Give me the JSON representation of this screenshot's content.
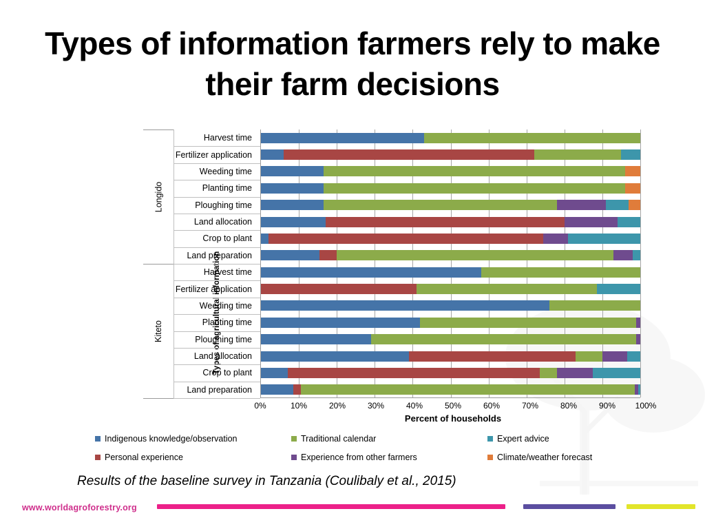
{
  "title": "Types of information farmers rely to make their farm decisions",
  "caption": "Results of the baseline survey in Tanzania (Coulibaly et al., 2015)",
  "footer": {
    "url": "www.worldagroforestry.org"
  },
  "chart_data": {
    "type": "bar",
    "orientation": "horizontal",
    "stacked": true,
    "stack_mode": "percent",
    "title": "",
    "xlabel": "Percent of households",
    "ylabel": "Types of agricultural information",
    "xlim": [
      0,
      100
    ],
    "xticks": [
      "0%",
      "10%",
      "20%",
      "30%",
      "40%",
      "50%",
      "60%",
      "70%",
      "80%",
      "90%",
      "100%"
    ],
    "grid": true,
    "legend_position": "bottom",
    "series": [
      {
        "name": "Indigenous knowledge/observation",
        "color": "#4574a8"
      },
      {
        "name": "Personal experience",
        "color": "#a84644"
      },
      {
        "name": "Traditional calendar",
        "color": "#8cab४a"
      },
      {
        "name": "Experience from other farmers",
        "color": "#6f4b8e"
      },
      {
        "name": "Expert advice",
        "color": "#3d96ab"
      },
      {
        "name": "Climate/weather forecast",
        "color": "#e07c3a"
      }
    ],
    "groups": [
      {
        "name": "Longido",
        "categories": [
          "Harvest time",
          "Fertilizer application",
          "Weeding time",
          "Planting time",
          "Ploughing time",
          "Land allocation",
          "Crop to plant",
          "Land preparation"
        ],
        "values": [
          [
            43.0,
            0.0,
            57.0,
            0.0,
            0.0,
            0.0
          ],
          [
            6.0,
            66.0,
            23.0,
            0.0,
            5.0,
            0.0
          ],
          [
            16.5,
            0.0,
            79.5,
            0.0,
            0.0,
            4.0
          ],
          [
            16.5,
            0.0,
            79.5,
            0.0,
            0.0,
            4.0
          ],
          [
            16.5,
            0.0,
            61.5,
            13.0,
            6.0,
            3.0
          ],
          [
            17.0,
            63.0,
            0.0,
            14.0,
            6.0,
            0.0
          ],
          [
            2.0,
            72.5,
            0.0,
            6.5,
            19.0,
            0.0
          ],
          [
            15.5,
            4.5,
            73.0,
            5.0,
            2.0,
            0.0
          ]
        ]
      },
      {
        "name": "Kiteto",
        "categories": [
          "Harvest time",
          "Fertilizer application",
          "Weeding time",
          "Planting time",
          "Ploughing time",
          "Land allocation",
          "Crop to plant",
          "Land preparation"
        ],
        "values": [
          [
            58.0,
            0.0,
            42.0,
            0.0,
            0.0,
            0.0
          ],
          [
            0.0,
            41.0,
            47.5,
            0.0,
            11.5,
            0.0
          ],
          [
            76.0,
            0.0,
            24.0,
            0.0,
            0.0,
            0.0
          ],
          [
            42.0,
            0.0,
            57.0,
            1.0,
            0.0,
            0.0
          ],
          [
            29.0,
            0.0,
            70.0,
            1.0,
            0.0,
            0.0
          ],
          [
            39.0,
            44.0,
            7.0,
            6.5,
            3.5,
            0.0
          ],
          [
            7.0,
            66.5,
            4.5,
            9.5,
            12.5,
            0.0
          ],
          [
            8.5,
            2.0,
            88.0,
            1.0,
            0.5,
            0.0
          ]
        ]
      }
    ]
  }
}
